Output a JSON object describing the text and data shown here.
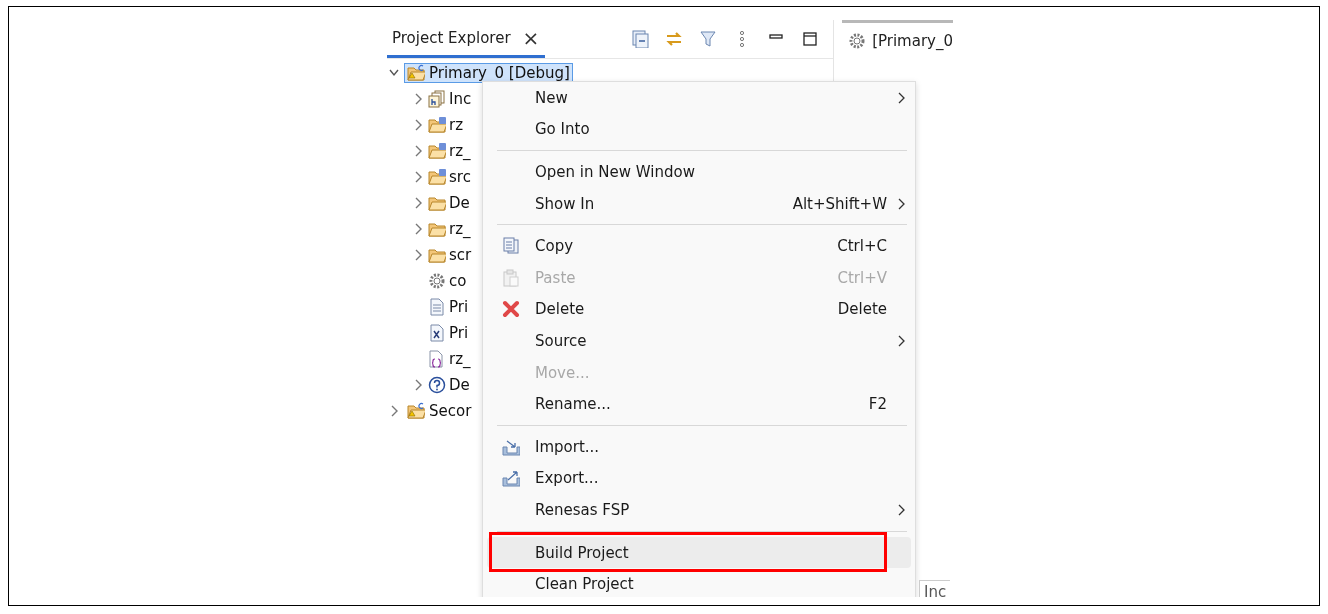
{
  "explorer": {
    "title": "Project Explorer",
    "close": "×"
  },
  "editor_tab": {
    "title": "[Primary_0"
  },
  "tree": [
    {
      "label": "Primary_0 [Debug]",
      "kind": "project",
      "expanded": true,
      "selected": true,
      "children": [
        {
          "label": "Inc",
          "kind": "headers",
          "expanded": false
        },
        {
          "label": "rz",
          "kind": "srcfolder",
          "expanded": false
        },
        {
          "label": "rz_",
          "kind": "srcfolder",
          "expanded": false
        },
        {
          "label": "src",
          "kind": "srcfolder",
          "expanded": false
        },
        {
          "label": "De",
          "kind": "folder",
          "expanded": false
        },
        {
          "label": "rz_",
          "kind": "folder",
          "expanded": false
        },
        {
          "label": "scr",
          "kind": "folder",
          "expanded": false
        },
        {
          "label": "co",
          "kind": "gear"
        },
        {
          "label": "Pri",
          "kind": "textfile"
        },
        {
          "label": "Pri",
          "kind": "xfile"
        },
        {
          "label": "rz_",
          "kind": "bracefile"
        },
        {
          "label": "De",
          "kind": "help",
          "expanded": false
        }
      ]
    },
    {
      "label": "Secor",
      "kind": "project",
      "expanded": false,
      "selected": false
    }
  ],
  "menu": [
    {
      "kind": "item",
      "label": "New",
      "submenu": true,
      "disabled": false
    },
    {
      "kind": "item",
      "label": "Go Into",
      "disabled": false
    },
    {
      "kind": "separator"
    },
    {
      "kind": "item",
      "label": "Open in New Window",
      "disabled": false
    },
    {
      "kind": "item",
      "label": "Show In",
      "shortcut": "Alt+Shift+W",
      "submenu": true,
      "disabled": false
    },
    {
      "kind": "separator"
    },
    {
      "kind": "copy",
      "label": "Copy",
      "shortcut": "Ctrl+C",
      "disabled": false
    },
    {
      "kind": "paste",
      "label": "Paste",
      "shortcut": "Ctrl+V",
      "disabled": true
    },
    {
      "kind": "delete",
      "label": "Delete",
      "shortcut": "Delete",
      "disabled": false
    },
    {
      "kind": "item",
      "label": "Source",
      "submenu": true,
      "disabled": false
    },
    {
      "kind": "item",
      "label": "Move...",
      "disabled": true
    },
    {
      "kind": "item",
      "label": "Rename...",
      "shortcut": "F2",
      "disabled": false
    },
    {
      "kind": "separator"
    },
    {
      "kind": "import",
      "label": "Import...",
      "disabled": false
    },
    {
      "kind": "export",
      "label": "Export...",
      "disabled": false
    },
    {
      "kind": "item",
      "label": "Renesas FSP",
      "submenu": true,
      "disabled": false
    },
    {
      "kind": "separator"
    },
    {
      "kind": "item",
      "label": "Build Project",
      "disabled": false,
      "highlighted": true,
      "annotated": true
    },
    {
      "kind": "item",
      "label": "Clean Project",
      "disabled": false
    }
  ],
  "editor_fragment": "Inc"
}
